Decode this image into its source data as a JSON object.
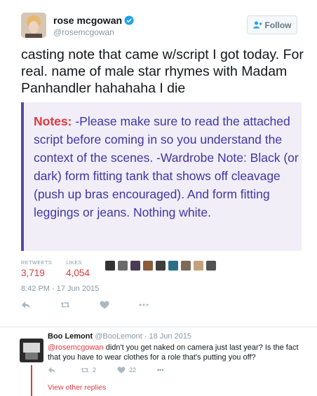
{
  "tweet": {
    "author_name": "rose mcgowan",
    "author_handle": "@rosemcgowan",
    "follow_label": "Follow",
    "text": "casting note that came w/script I got today. For real. name of male star rhymes with Madam Panhandler hahahaha I die",
    "note": {
      "label": "Notes:",
      "body": " -Please make sure to read the attached script before coming in so you understand the context of the scenes. -Wardrobe Note: Black (or dark) form fitting tank that shows off cleavage (push up bras encouraged). And form fitting leggings or jeans. Nothing white."
    },
    "stats": {
      "retweets_label": "RETWEETS",
      "retweets_value": "3,719",
      "likes_label": "LIKES",
      "likes_value": "4,054"
    },
    "timestamp": "8:42 PM - 17 Jun 2015"
  },
  "reply": {
    "author_name": "Boo Lemont",
    "author_handle": "@BooLemont",
    "separator": " · ",
    "date": "18 Jun 2015",
    "mention": "@rosemcgowan",
    "text": " didn't you get naked on camera just last year? Is the fact that you have to wear clothes for a role that's putting you off?",
    "retweet_count": "2",
    "like_count": "22",
    "more_label": "•••",
    "view_other_replies": "View other replies"
  },
  "colors": {
    "accent": "#e0383d",
    "note_text": "#3f35a6",
    "note_bg": "#f1eef8",
    "muted": "#8899a6"
  },
  "icons": {
    "verified": "verified-badge-icon",
    "follow": "add-user-icon",
    "reply": "reply-icon",
    "retweet": "retweet-icon",
    "like": "heart-icon",
    "more": "more-icon"
  }
}
